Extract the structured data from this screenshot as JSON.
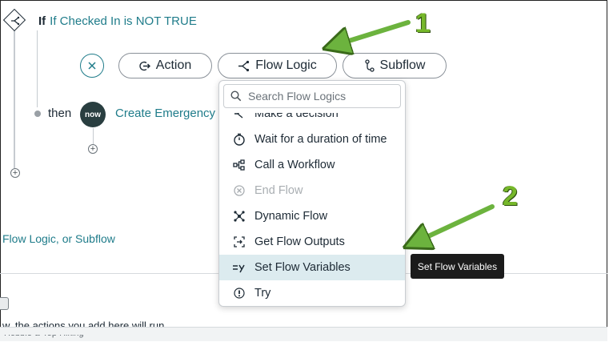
{
  "condition": {
    "keyword": "If",
    "text": "If Checked In is NOT TRUE"
  },
  "toolbar": {
    "action_label": "Action",
    "flow_logic_label": "Flow Logic",
    "subflow_label": "Subflow"
  },
  "branch": {
    "then_label": "then",
    "badge_text": "now",
    "action_text": "Create Emergency T"
  },
  "hint_text": "Flow Logic, or Subflow",
  "bottom_text": "w, the actions you add here will run",
  "footer_text": "Hobble-a-Top Hiking",
  "dropdown": {
    "search_placeholder": "Search Flow Logics",
    "items": [
      {
        "label": "Make a decision",
        "icon": "decision-icon",
        "state": "partial"
      },
      {
        "label": "Wait for a duration of time",
        "icon": "timer-icon",
        "state": "normal"
      },
      {
        "label": "Call a Workflow",
        "icon": "workflow-icon",
        "state": "normal"
      },
      {
        "label": "End Flow",
        "icon": "end-flow-icon",
        "state": "disabled"
      },
      {
        "label": "Dynamic Flow",
        "icon": "dynamic-flow-icon",
        "state": "normal"
      },
      {
        "label": "Get Flow Outputs",
        "icon": "get-outputs-icon",
        "state": "normal"
      },
      {
        "label": "Set Flow Variables",
        "icon": "set-variables-icon",
        "state": "selected"
      },
      {
        "label": "Try",
        "icon": "try-icon",
        "state": "normal"
      }
    ]
  },
  "tooltip": "Set Flow Variables",
  "annotations": {
    "step1": "1",
    "step2": "2",
    "arrow_color": "#6cb33e"
  },
  "colors": {
    "link": "#1f7c8a",
    "selected_bg": "#dcebef",
    "tooltip_bg": "#1b1b1b"
  }
}
